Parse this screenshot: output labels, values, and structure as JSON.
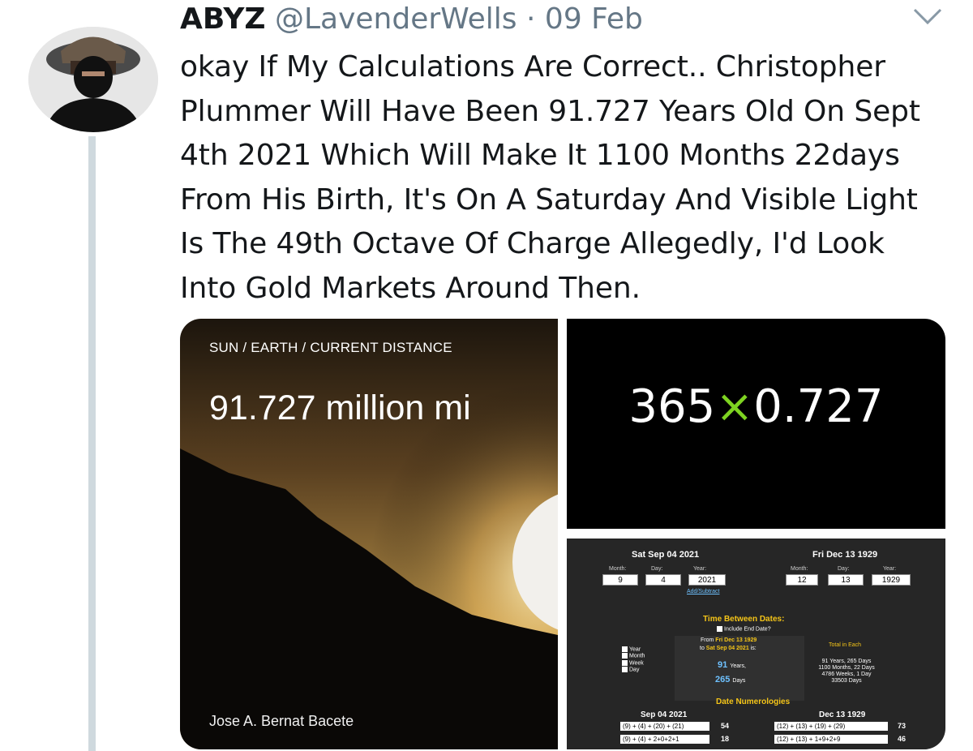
{
  "tweet": {
    "display_name": "ABYZ",
    "handle": "@LavenderWells",
    "separator": "·",
    "date": "09 Feb",
    "text": "okay If My Calculations Are Correct.. Christopher\nPlummer Will Have Been 91.727 Years Old On Sept\n4th 2021 Which Will Make It 1100 Months 22days\nFrom His Birth, It's On A Saturday And Visible Light\nIs The 49th Octave Of Charge Allegedly, I'd Look\nInto Gold Markets Around Then."
  },
  "media1": {
    "caption": "SUN / EARTH / CURRENT DISTANCE",
    "distance": "91.727 million mi",
    "credit": "Jose A. Bernat Bacete"
  },
  "media2": {
    "left": "365",
    "operator": "×",
    "right": "0.727"
  },
  "media3": {
    "date_a": {
      "title": "Sat Sep 04 2021",
      "month_label": "Month:",
      "day_label": "Day:",
      "year_label": "Year:",
      "month": "9",
      "day": "4",
      "year": "2021"
    },
    "date_b": {
      "title": "Fri Dec 13 1929",
      "month_label": "Month:",
      "day_label": "Day:",
      "year_label": "Year:",
      "month": "12",
      "day": "13",
      "year": "1929"
    },
    "add_subtract": "Add/Subtract",
    "time_between": "Time Between Dates:",
    "include_end": "Include End Date?",
    "from_label": "From",
    "from_date": "Fri Dec 13 1929",
    "to_label": "to",
    "to_date": "Sat Sep 04 2021",
    "to_suffix": "is:",
    "units": [
      "Year",
      "Month",
      "Week",
      "Day"
    ],
    "years_value": "91",
    "years_unit": "Years,",
    "days_value": "265",
    "days_unit": "Days",
    "total_title": "Total in Each",
    "totals": [
      "91 Years, 265 Days",
      "1100 Months, 22 Days",
      "4786 Weeks, 1 Day",
      "33503 Days"
    ],
    "numerologies_title": "Date Numerologies",
    "num_a": {
      "title": "Sep 04 2021",
      "rows": [
        {
          "expr": "(9) + (4) + (20) + (21)",
          "value": "54"
        },
        {
          "expr": "(9) + (4) + 2+0+2+1",
          "value": "18"
        }
      ]
    },
    "num_b": {
      "title": "Dec 13 1929",
      "rows": [
        {
          "expr": "(12) + (13) + (19) + (29)",
          "value": "73"
        },
        {
          "expr": "(12) + (13) + 1+9+2+9",
          "value": "46"
        }
      ]
    }
  },
  "colors": {
    "accent_green": "#7ed321",
    "calc_yellow": "#f5c518",
    "muted": "#657786"
  }
}
